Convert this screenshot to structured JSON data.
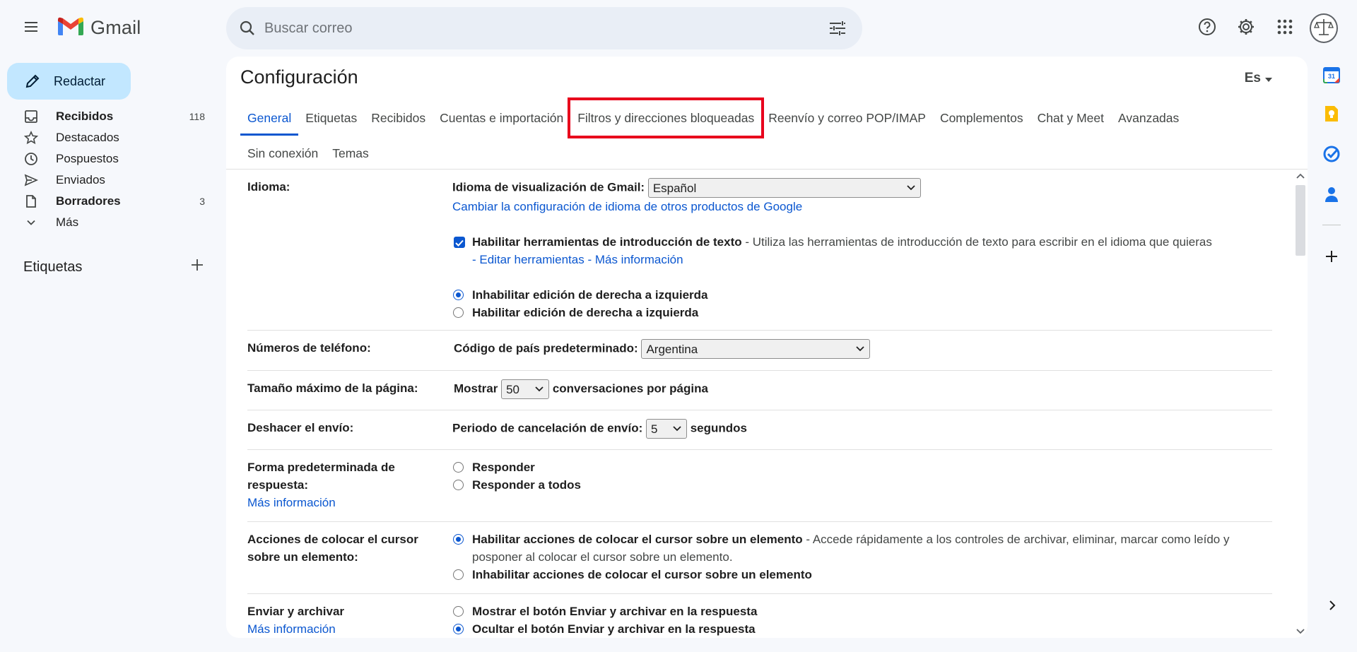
{
  "app": {
    "name": "Gmail",
    "accent_color": "#0b57d0",
    "highlight_color": "#e8001c"
  },
  "search": {
    "placeholder": "Buscar correo"
  },
  "compose": {
    "label": "Redactar"
  },
  "sidebar": {
    "items": [
      {
        "label": "Recibidos",
        "count": "118",
        "icon": "inbox-icon",
        "bold": true
      },
      {
        "label": "Destacados",
        "count": "",
        "icon": "star-icon",
        "bold": false
      },
      {
        "label": "Pospuestos",
        "count": "",
        "icon": "clock-icon",
        "bold": false
      },
      {
        "label": "Enviados",
        "count": "",
        "icon": "send-icon",
        "bold": false
      },
      {
        "label": "Borradores",
        "count": "3",
        "icon": "draft-icon",
        "bold": true
      },
      {
        "label": "Más",
        "count": "",
        "icon": "chevron-down-icon",
        "bold": false
      }
    ],
    "labels_title": "Etiquetas"
  },
  "settings": {
    "title": "Configuración",
    "language_button": "Es",
    "tabs_row1": [
      {
        "label": "General",
        "active": true
      },
      {
        "label": "Etiquetas"
      },
      {
        "label": "Recibidos"
      },
      {
        "label": "Cuentas e importación"
      },
      {
        "label": "Filtros y direcciones bloqueadas",
        "highlighted": true
      },
      {
        "label": "Reenvío y correo POP/IMAP"
      },
      {
        "label": "Complementos"
      },
      {
        "label": "Chat y Meet"
      },
      {
        "label": "Avanzadas"
      }
    ],
    "tabs_row2": [
      {
        "label": "Sin conexión"
      },
      {
        "label": "Temas"
      }
    ],
    "sections": {
      "idioma": {
        "label": "Idioma:",
        "display_lang_label": "Idioma de visualización de Gmail:",
        "display_lang_value": "Español",
        "change_link": "Cambiar la configuración de idioma de otros productos de Google",
        "input_tools_label": "Habilitar herramientas de introducción de texto",
        "input_tools_desc": " - Utiliza las herramientas de introducción de texto para escribir en el idioma que quieras",
        "dash1": "- ",
        "edit_tools_link": "Editar herramientas",
        "dash2": " - ",
        "more_info_link": "Más información",
        "rtl_disable": "Inhabilitar edición de derecha a izquierda",
        "rtl_enable": "Habilitar edición de derecha a izquierda"
      },
      "phone": {
        "label": "Números de teléfono:",
        "country_label": "Código de país predeterminado:",
        "country_value": "Argentina"
      },
      "page_size": {
        "label": "Tamaño máximo de la página:",
        "show": "Mostrar",
        "value": "50",
        "suffix": "conversaciones por página"
      },
      "undo_send": {
        "label": "Deshacer el envío:",
        "period_label": "Periodo de cancelación de envío:",
        "value": "5",
        "suffix": "segundos"
      },
      "reply_default": {
        "label": "Forma predeterminada de respuesta:",
        "more_info": "Más información",
        "reply": "Responder",
        "reply_all": "Responder a todos"
      },
      "hover_actions": {
        "label": "Acciones de colocar el cursor sobre un elemento:",
        "enable": "Habilitar acciones de colocar el cursor sobre un elemento",
        "enable_desc": " - Accede rápidamente a los controles de archivar, eliminar, marcar como leído y posponer al colocar el cursor sobre un elemento.",
        "disable": "Inhabilitar acciones de colocar el cursor sobre un elemento"
      },
      "send_archive": {
        "label": "Enviar y archivar",
        "more_info": "Más información",
        "show": "Mostrar el botón Enviar y archivar en la respuesta",
        "hide": "Ocultar el botón Enviar y archivar en la respuesta"
      }
    }
  },
  "side_panel": {
    "icons": [
      "calendar-icon",
      "keep-icon",
      "tasks-icon",
      "contacts-icon",
      "plus-icon"
    ],
    "calendar_day": "31"
  }
}
